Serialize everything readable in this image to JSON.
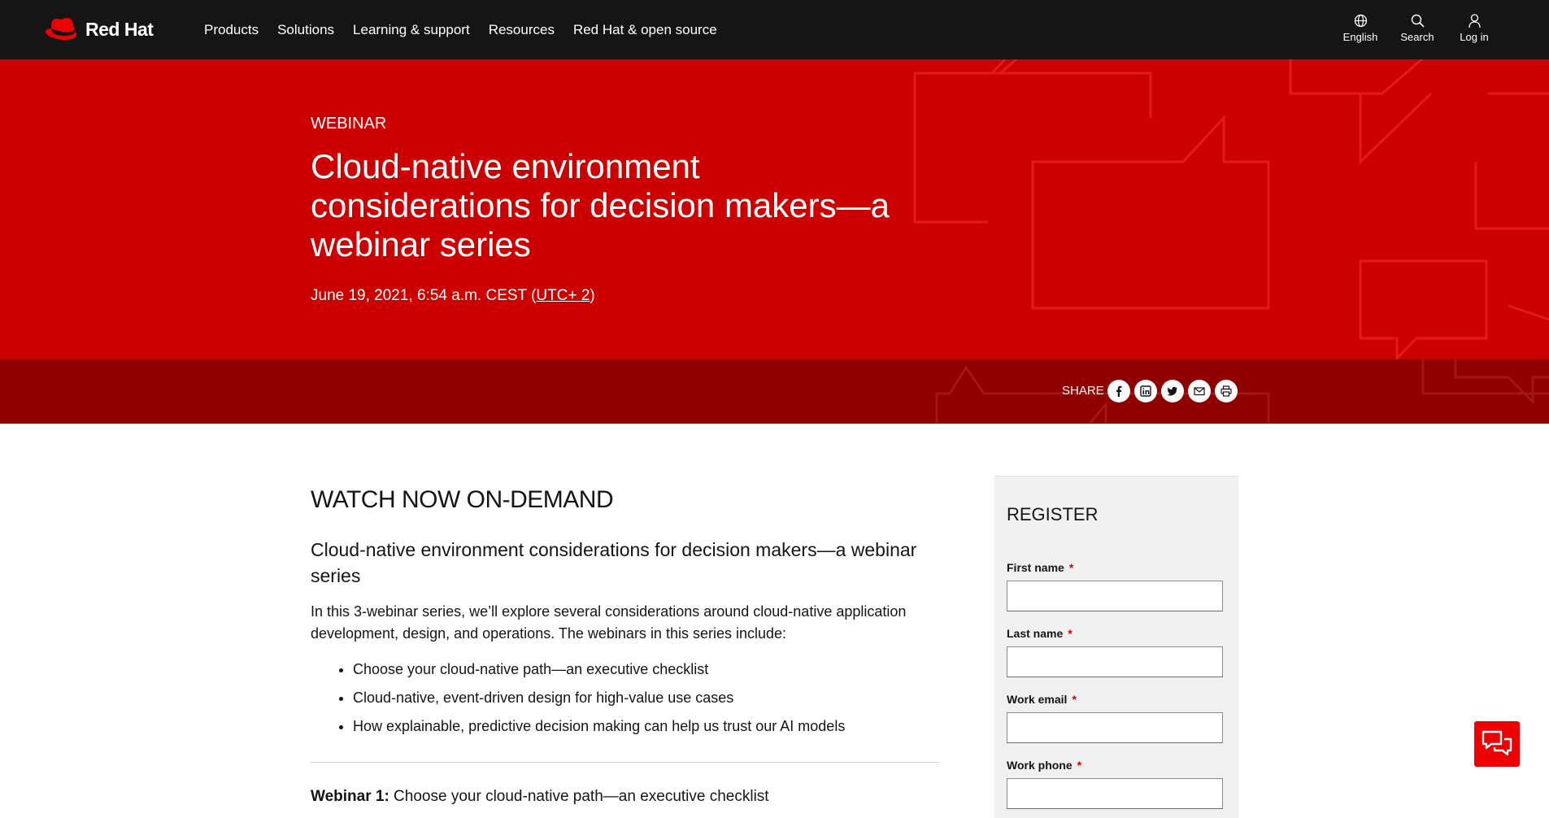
{
  "brand": {
    "name": "Red Hat",
    "accent": "#ee0000",
    "hero_bg": "#cc0000",
    "sharebar_bg": "#8f0000",
    "nav_bg": "#151515"
  },
  "nav": {
    "items": [
      "Products",
      "Solutions",
      "Learning & support",
      "Resources",
      "Red Hat & open source"
    ],
    "utility": [
      {
        "label": "English",
        "icon": "globe-icon"
      },
      {
        "label": "Search",
        "icon": "search-icon"
      },
      {
        "label": "Log in",
        "icon": "user-icon"
      }
    ]
  },
  "hero": {
    "eyebrow": "WEBINAR",
    "title": "Cloud-native environment considerations for decision makers—a webinar series",
    "date_prefix": "June 19, 2021, 6:54 a.m. CEST (",
    "timezone_link": "UTC+ 2",
    "date_suffix": ")"
  },
  "share": {
    "label": "SHARE",
    "buttons": [
      "facebook-icon",
      "linkedin-icon",
      "twitter-icon",
      "email-icon",
      "print-icon"
    ]
  },
  "main": {
    "heading": "WATCH NOW ON-DEMAND",
    "subheading": "Cloud-native environment considerations for decision makers—a webinar series",
    "intro": "In this 3-webinar series, we’ll explore several considerations around cloud-native application development, design, and operations. The webinars in this series include:",
    "list": [
      "Choose your cloud-native path—an executive checklist",
      "Cloud-native, event-driven design for high-value use cases",
      "How explainable, predictive decision making can help us trust our AI models"
    ],
    "cutoff_bold": "Webinar 1:",
    "cutoff_text": " Choose your cloud-native path—an executive checklist"
  },
  "form": {
    "title": "REGISTER",
    "required_mark": "*",
    "fields": [
      {
        "label": "First name",
        "value": ""
      },
      {
        "label": "Last name",
        "value": ""
      },
      {
        "label": "Work email",
        "value": ""
      },
      {
        "label": "Work phone",
        "value": ""
      }
    ]
  },
  "chat": {
    "icon": "chat-icon"
  }
}
